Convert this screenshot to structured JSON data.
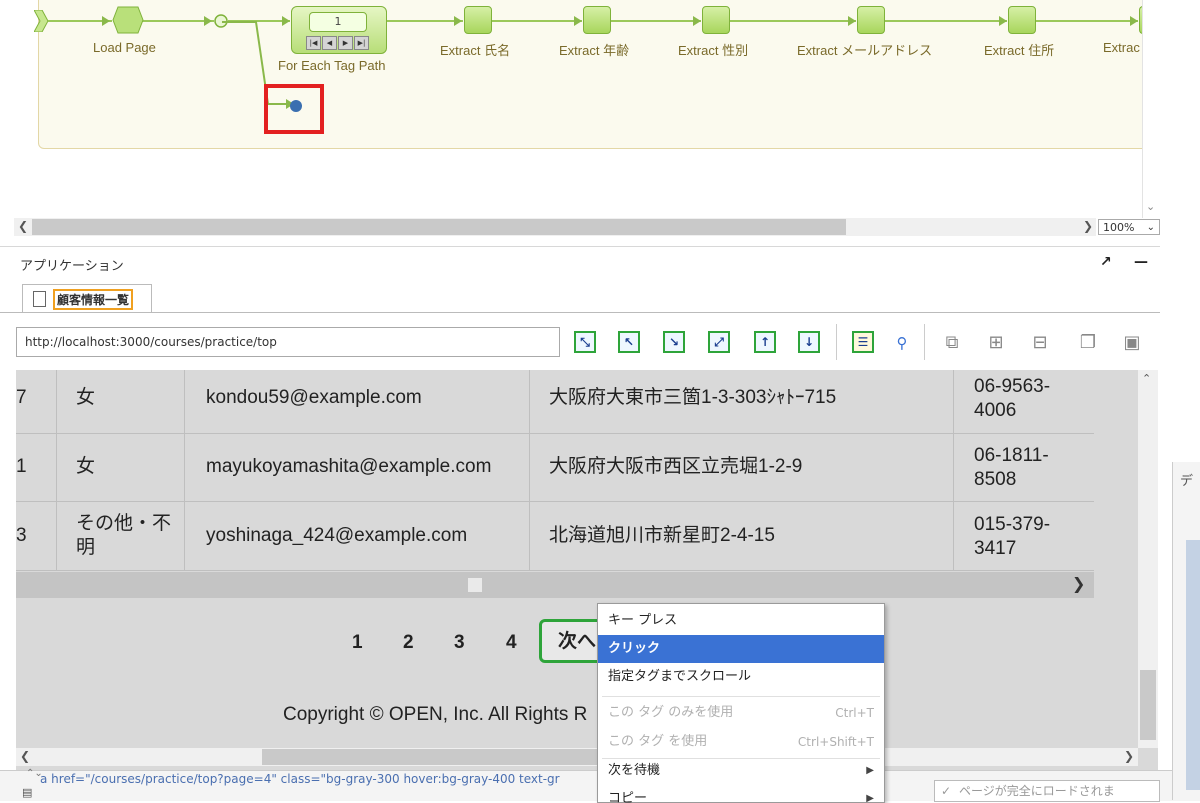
{
  "workflow": {
    "steps": [
      {
        "label": "Load Page"
      },
      {
        "label": "For Each Tag Path",
        "counter": "1"
      },
      {
        "label": "Extract 氏名"
      },
      {
        "label": "Extract 年齢"
      },
      {
        "label": "Extract 性別"
      },
      {
        "label": "Extract メールアドレス"
      },
      {
        "label": "Extract 住所"
      },
      {
        "label": "Extrac"
      }
    ],
    "zoom": "100%"
  },
  "panel": {
    "title": "アプリケーション",
    "tab_label": "顧客情報一覧"
  },
  "toolbar": {
    "url": "http://localhost:3000/courses/practice/top"
  },
  "table": {
    "rows": [
      {
        "id": "7",
        "gender": "女",
        "email": "kondou59@example.com",
        "address": "大阪府大東市三箇1-3-303ｼｬﾄｰ715",
        "phone_a": "06-9563-",
        "phone_b": "4006"
      },
      {
        "id": "1",
        "gender": "女",
        "email": "mayukoyamashita@example.com",
        "address": "大阪府大阪市西区立売堀1-2-9",
        "phone_a": "06-1811-",
        "phone_b": "8508"
      },
      {
        "id": "3",
        "gender_a": "その他・不",
        "gender_b": "明",
        "email": "yoshinaga_424@example.com",
        "address": "北海道旭川市新星町2-4-15",
        "phone_a": "015-379-",
        "phone_b": "3417"
      }
    ]
  },
  "pagination": {
    "pages": [
      "1",
      "2",
      "3",
      "4"
    ],
    "next": "次へ"
  },
  "footer": {
    "copyright": "Copyright © OPEN, Inc. All Rights R"
  },
  "context_menu": {
    "items": [
      {
        "label": "キー プレス"
      },
      {
        "label": "クリック"
      },
      {
        "label": "指定タグまでスクロール"
      },
      {
        "label": "この タグ のみを使用",
        "shortcut": "Ctrl+T"
      },
      {
        "label": "この タグ を使用",
        "shortcut": "Ctrl+Shift+T"
      },
      {
        "label": "次を待機"
      },
      {
        "label": "コピー"
      }
    ]
  },
  "status": {
    "html_path": "a href=\"/courses/practice/top?page=4\" class=\"bg-gray-300 hover:bg-gray-400 text-gr",
    "wait_label": "ページが完全にロードされま",
    "side_char": "デ"
  }
}
